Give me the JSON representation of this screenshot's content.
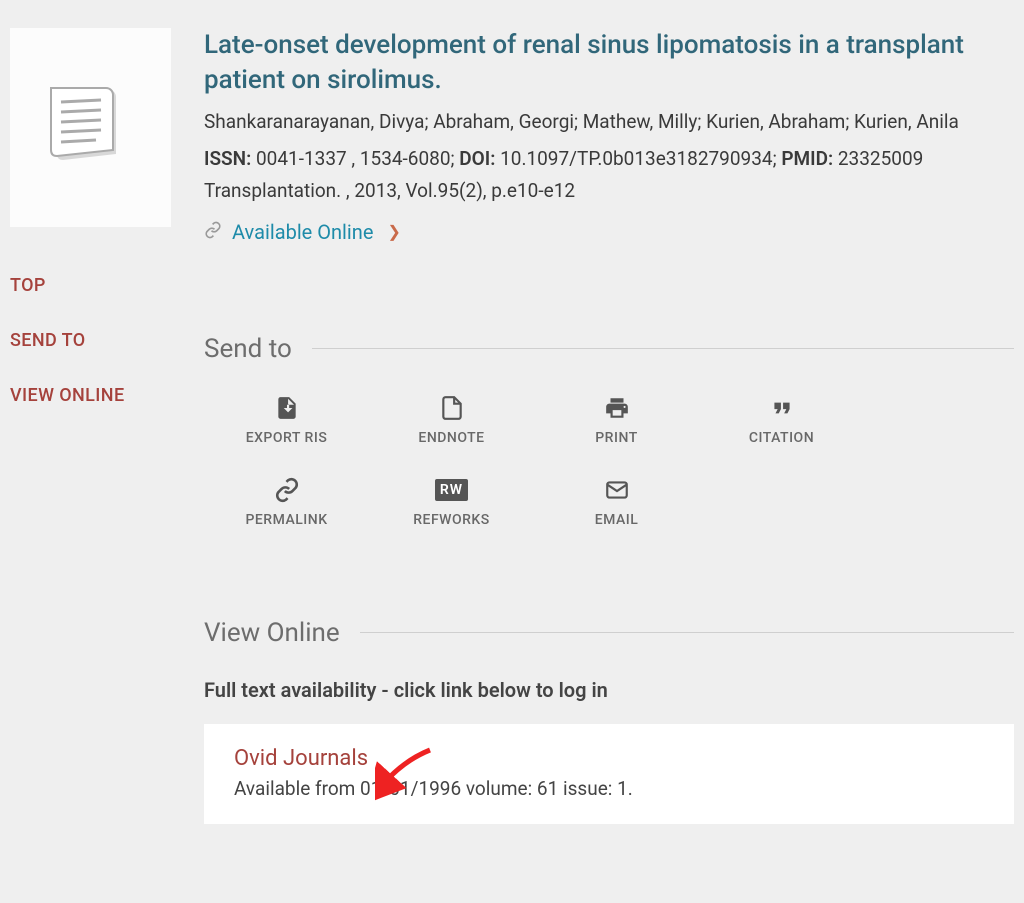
{
  "sidebar": {
    "top": "TOP",
    "sendto": "SEND TO",
    "viewonline": "VIEW ONLINE"
  },
  "record": {
    "title": "Late-onset development of renal sinus lipomatosis in a transplant patient on sirolimus.",
    "authors": "Shankaranarayanan, Divya; Abraham, Georgi; Mathew, Milly; Kurien, Abraham; Kurien, Anila",
    "issn_label": "ISSN:",
    "issn_value": " 0041-1337 , 1534-6080; ",
    "doi_label": "DOI:",
    "doi_value": " 10.1097/TP.0b013e3182790934; ",
    "pmid_label": "PMID:",
    "pmid_value": " 23325009",
    "citation": "Transplantation. , 2013, Vol.95(2), p.e10-e12",
    "available_link": "Available Online"
  },
  "sections": {
    "sendto_title": "Send to",
    "viewonline_title": "View Online"
  },
  "actions": {
    "export_ris": "EXPORT RIS",
    "endnote": "ENDNOTE",
    "print": "PRINT",
    "citation": "CITATION",
    "permalink": "PERMALINK",
    "refworks": "REFWORKS",
    "refworks_badge": "RW",
    "email": "EMAIL"
  },
  "viewonline": {
    "fulltext_heading": "Full text availability - click link below to log in",
    "source_name": "Ovid Journals",
    "source_availability": "Available from 01/01/1996 volume: 61 issue: 1."
  }
}
